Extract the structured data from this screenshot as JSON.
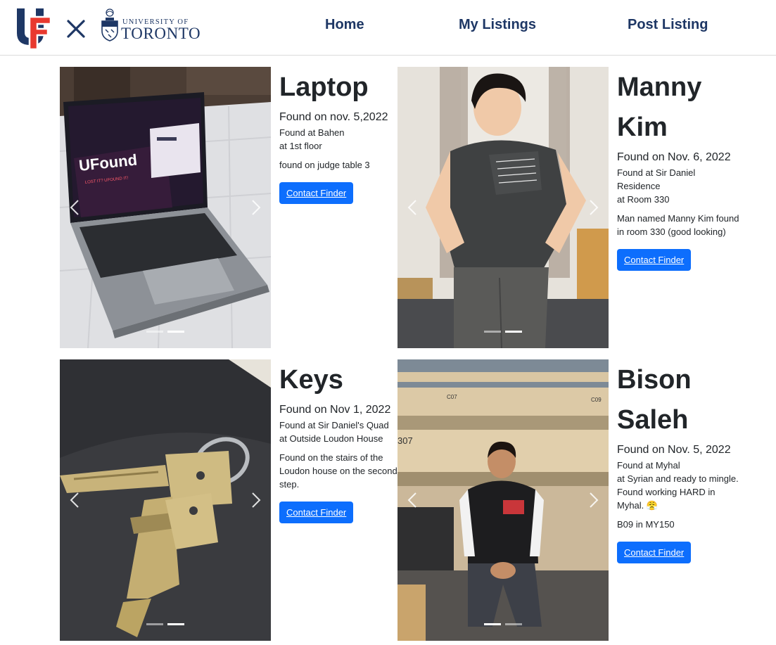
{
  "nav": {
    "brand_cross": "×",
    "uoft_line1": "UNIVERSITY OF",
    "uoft_line2": "TORONTO",
    "links": [
      "Home",
      "My Listings",
      "Post Listing"
    ]
  },
  "colors": {
    "navy": "#1e3765",
    "uf_red": "#e8392f",
    "button_blue": "#0d6efd"
  },
  "listings": [
    {
      "title": "Laptop",
      "found_date": "Found on nov. 5,2022",
      "location": "Found at Bahen",
      "detail": "at 1st floor",
      "description": "found on judge table 3",
      "button": "Contact Finder",
      "screen_title": "UFound",
      "screen_tagline": "LOST IT? UFOUND IT!",
      "slide_count": 2,
      "active_slide": 2
    },
    {
      "title": "Manny Kim",
      "found_date": "Found on Nov. 6, 2022",
      "location": "Found at Sir Daniel Residence",
      "detail": "at Room 330",
      "description": "Man named Manny Kim found in room 330 (good looking)",
      "button": "Contact Finder",
      "slide_count": 2,
      "active_slide": 2
    },
    {
      "title": "Keys",
      "found_date": "Found on Nov 1, 2022",
      "location": "Found at Sir Daniel's Quad",
      "detail": "at Outside Loudon House",
      "description": "Found on the stairs of the Loudon house on the second step.",
      "button": "Contact Finder",
      "slide_count": 2,
      "active_slide": 2
    },
    {
      "title": "Bison Saleh",
      "found_date": "Found on Nov. 5, 2022",
      "location": "Found at Myhal",
      "detail": "at Syrian and ready to mingle. Found working HARD in Myhal. 😤",
      "description": "B09 in MY150",
      "button": "Contact Finder",
      "seat_labels": [
        "C07",
        "C09",
        "307"
      ],
      "slide_count": 2,
      "active_slide": 1
    }
  ]
}
